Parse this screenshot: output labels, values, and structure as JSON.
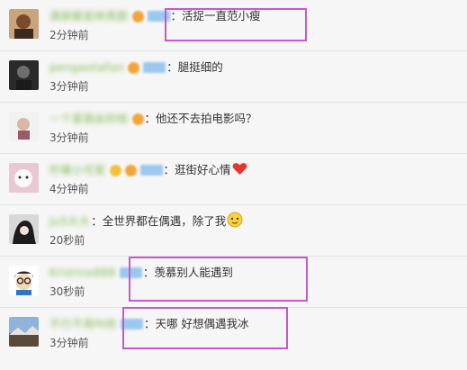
{
  "comments": [
    {
      "username": "满屏都是林燕鹊",
      "text": "：活捉一直范小瘦",
      "time": "2分钟前"
    },
    {
      "username": "pengaotaFan",
      "text": "：腿挺细的",
      "time": "3分钟前"
    },
    {
      "username": "一个爱丽丝的他",
      "text": "：他还不去拍电影吗？",
      "time": "3分钟前"
    },
    {
      "username": "柠檬小可爱",
      "text": "：逛街好心情",
      "time": "4分钟前"
    },
    {
      "username": "JuS大大",
      "text": "：全世界都在偶遇，除了我",
      "time": "20秒前"
    },
    {
      "username": "Kristine888",
      "text": "：羡慕别人能遇到",
      "time": "30秒前"
    },
    {
      "username": "不行不用叫你",
      "text": "：天哪 好想偶遇我冰",
      "time": "3分钟前"
    }
  ],
  "icons": {
    "heart": "red-heart-icon",
    "emoji": "yellow-face-emoji-icon"
  },
  "colors": {
    "highlight_box": "#c659c9",
    "username": "#7fb84f",
    "vip_tag": "#9cc8ee"
  }
}
